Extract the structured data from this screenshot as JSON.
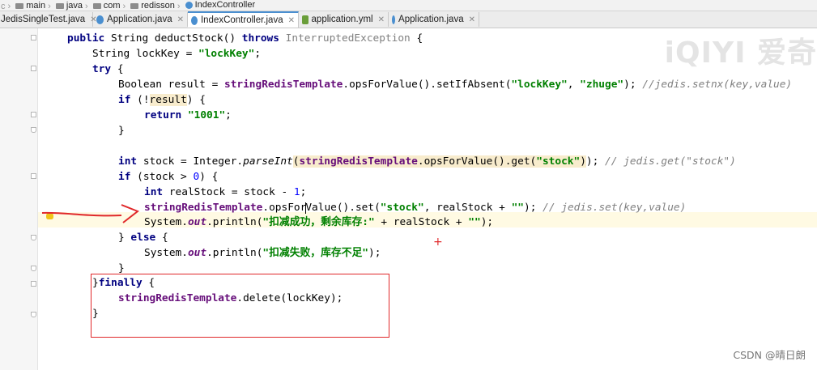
{
  "breadcrumb": [
    {
      "label": "main",
      "icon": "folder"
    },
    {
      "label": "java",
      "icon": "folder"
    },
    {
      "label": "com",
      "icon": "folder"
    },
    {
      "label": "redisson",
      "icon": "folder"
    },
    {
      "label": "IndexController",
      "icon": "class"
    }
  ],
  "tabs": [
    {
      "label": "JedisSingleTest.java",
      "active": false,
      "icon": "class"
    },
    {
      "label": "Application.java",
      "active": false,
      "icon": "class"
    },
    {
      "label": "IndexController.java",
      "active": true,
      "icon": "class"
    },
    {
      "label": "application.yml",
      "active": false,
      "icon": "yml"
    },
    {
      "label": "Application.java",
      "active": false,
      "icon": "class"
    }
  ],
  "watermark": "iQIYI 爱奇",
  "credit": "CSDN @晴日朗",
  "code": {
    "l1_kw1": "public",
    "l1_a": " String deductStock() ",
    "l1_kw2": "throws",
    "l1_ex": " InterruptedException",
    "l1_b": " {",
    "l2_a": "String lockKey = ",
    "l2_str": "\"lockKey\"",
    "l2_b": ";",
    "l3_kw": "try",
    "l3_b": " {",
    "l4_a": "Boolean result = ",
    "l4_fld": "stringRedisTemplate",
    "l4_b": ".opsForValue().setIfAbsent(",
    "l4_s1": "\"lockKey\"",
    "l4_c": ", ",
    "l4_s2": "\"zhuge\"",
    "l4_d": "); ",
    "l4_cmt": "//jedis.setnx(key,value)",
    "l5_kw": "if",
    "l5_a": " (!",
    "l5_res": "result",
    "l5_b": ") {",
    "l6_kw": "return",
    "l6_str": " \"1001\"",
    "l6_b": ";",
    "l7": "}",
    "l9_kw": "int",
    "l9_a": " stock = Integer.",
    "l9_m": "parseInt",
    "l9_b": "(",
    "l9_fld": "stringRedisTemplate",
    "l9_c": ".opsForValue().get(",
    "l9_s": "\"stock\"",
    "l9_d": ")",
    "l9_e": "); ",
    "l9_cmt": "// jedis.get(\"stock\")",
    "l10_kw": "if",
    "l10_a": " (stock > ",
    "l10_n": "0",
    "l10_b": ") {",
    "l11_kw": "int",
    "l11_a": " realStock = stock - ",
    "l11_n": "1",
    "l11_b": ";",
    "l12_fld": "stringRedisTemplate",
    "l12_a": ".opsFor",
    "l12_a2": "Value().set(",
    "l12_s1": "\"stock\"",
    "l12_b": ", realStock + ",
    "l12_s2": "\"\"",
    "l12_c": "); ",
    "l12_cmt": "// jedis.set(key,value)",
    "l13_a": "System.",
    "l13_out": "out",
    "l13_b": ".println(",
    "l13_s1": "\"扣减成功，剩余库存:\"",
    "l13_c": " + realStock + ",
    "l13_s2": "\"\"",
    "l13_d": ");",
    "l14_a": "} ",
    "l14_kw": "else",
    "l14_b": " {",
    "l15_a": "System.",
    "l15_out": "out",
    "l15_b": ".println(",
    "l15_s": "\"扣减失败，库存不足\"",
    "l15_c": ");",
    "l16": "}",
    "l17_a": "}",
    "l17_kw": "finally",
    "l17_b": " {",
    "l18_fld": "stringRedisTemplate",
    "l18_a": ".delete(lockKey);",
    "l19": "}"
  },
  "colors": {
    "keyword": "#000080",
    "string": "#008000",
    "field": "#660e7a",
    "comment": "#808080",
    "number": "#0000ff",
    "annotation_red": "#e0282a",
    "current_line": "#fffae3"
  }
}
